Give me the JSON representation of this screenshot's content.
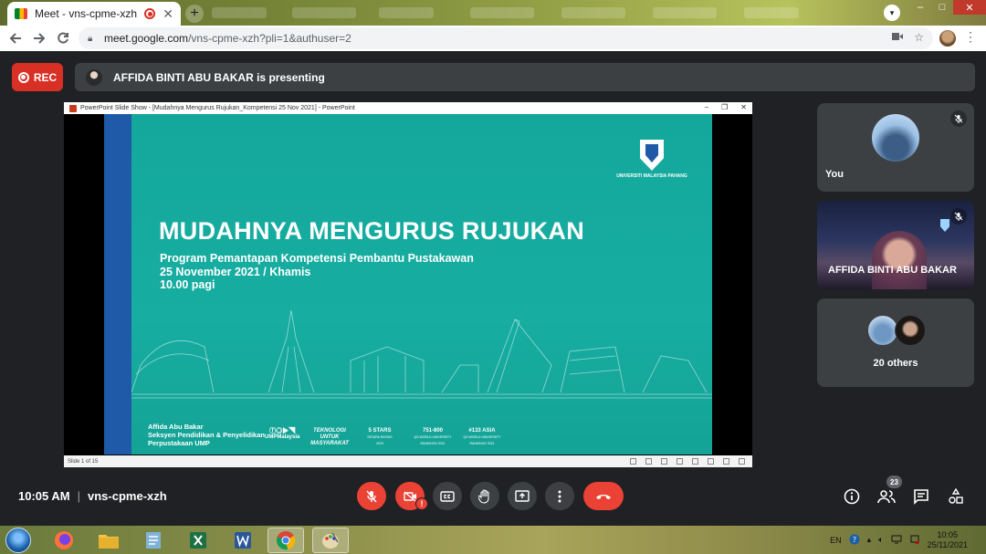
{
  "browser": {
    "tab_title": "Meet - vns-cpme-xzh",
    "tab_close": "✕",
    "new_tab": "+",
    "url_host": "meet.google.com",
    "url_rest": "/vns-cpme-xzh?pli=1&authuser=2",
    "controls": {
      "minimize": "–",
      "maximize": "□",
      "close": "✕"
    }
  },
  "meet": {
    "rec_label": "REC",
    "presenting_text": "AFFIDA BINTI ABU BAKAR is presenting",
    "meeting_time": "10:05 AM",
    "meeting_code": "vns-cpme-xzh",
    "participants_count": "23",
    "alert_badge": "!",
    "colors": {
      "red": "#ea4335",
      "tile": "#3c4043",
      "background": "#202124"
    }
  },
  "powerpoint": {
    "window_title": "PowerPoint Slide Show - [Mudahnya Mengurus Rujukan_Kompetensi 25 Nov 2021] - PowerPoint",
    "status_text": "Slide 1 of 15",
    "controls": {
      "minimize": "–",
      "restore": "❐",
      "close": "✕"
    }
  },
  "slide": {
    "title": "MUDAHNYA MENGURUS RUJUKAN",
    "subtitle_line1": "Program Pemantapan Kompetensi Pembantu Pustakawan",
    "subtitle_line2": "25 November 2021 / Khamis",
    "subtitle_line3": "10.00 pagi",
    "logo_text": "UNIVERSITI MALAYSIA PAHANG",
    "footer_name1": "Affida Abu Bakar",
    "footer_name2": "Seksyen Pendidikan & Penyelidikan",
    "footer_name3": "Perpustakaan UMP",
    "footer_items": [
      {
        "label": "UMPMalaysia",
        "sub": ""
      },
      {
        "label": "TEKNOLOGI UNTUK MASYARAKAT",
        "sub": ""
      },
      {
        "label": "5 STARS",
        "sub": "SETARA RATING 2019"
      },
      {
        "label": "751-800",
        "sub": "QS WORLD UNIVERSITY RANKINGS 2021"
      },
      {
        "label": "#133 ASIA",
        "sub": "QS WORLD UNIVERSITY RANKINGS 2021"
      }
    ]
  },
  "participants": [
    {
      "name": "You",
      "muted": true
    },
    {
      "name": "AFFIDA BINTI ABU BAKAR",
      "muted": true
    },
    {
      "name": "20 others",
      "muted": false
    }
  ],
  "taskbar": {
    "language": "EN",
    "time": "10:05",
    "date": "25/11/2021"
  }
}
